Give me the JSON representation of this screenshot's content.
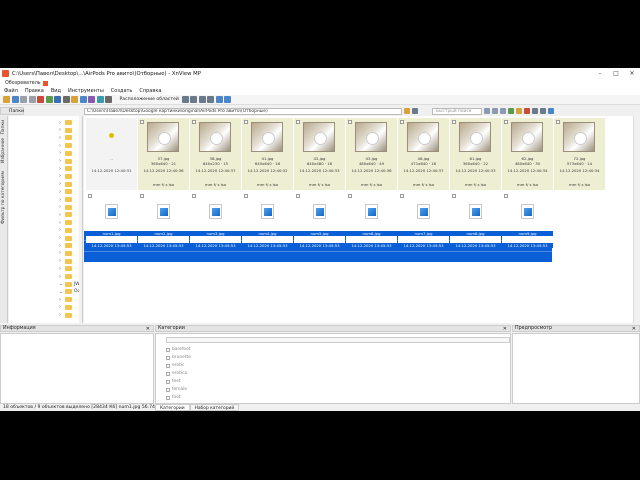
{
  "window": {
    "title": "C:\\Users\\Павел\\Desktop\\...\\AirPods Pro авито\\(Отборные) - XnView MP",
    "app_badge": "Обозреватель",
    "controls": [
      "–",
      "□",
      "✕"
    ]
  },
  "menu": [
    "Файл",
    "Правка",
    "Вид",
    "Инструменты",
    "Создать",
    "Справка"
  ],
  "toolbar": {
    "view_label": "Расположение областей"
  },
  "addressbar": {
    "tree_tab": "Папки",
    "path": "C:\\Users\\Павел\\Desktop\\Google картинки\\original\\AirPods Pro авито\\(Отборные)",
    "filter_placeholder": "Быстрый поиск"
  },
  "sidebar_tabs": [
    "Папки",
    "Избранное",
    "Фильтр по категориям"
  ],
  "tree": {
    "items": [
      "",
      "",
      "",
      "",
      "",
      "",
      "",
      "",
      "",
      "",
      "",
      "",
      "",
      "",
      "",
      "",
      "",
      "",
      "",
      "",
      "",
      "JW",
      "Ocn",
      "",
      "",
      ""
    ]
  },
  "thumbnails": [
    {
      "name": "..",
      "dims": "",
      "date": "14.12.2020 12:40:31",
      "rating": "",
      "type": "parent"
    },
    {
      "name": "37.jpg",
      "dims": "360x640 · 21",
      "date": "14.12.2020 12:40:36",
      "rating": "mm f/ s iso",
      "type": "photo"
    },
    {
      "name": "38.jpg",
      "dims": "640x230 · 15",
      "date": "14.12.2020 12:40:37",
      "rating": "mm f/ s iso",
      "type": "photo"
    },
    {
      "name": "41.jpg",
      "dims": "640x640 · 16",
      "date": "14.12.2020 12:40:32",
      "rating": "mm f/ s iso",
      "type": "photo"
    },
    {
      "name": "42.jpg",
      "dims": "640x480 · 16",
      "date": "14.12.2020 12:40:33",
      "rating": "mm f/ s iso",
      "type": "photo"
    },
    {
      "name": "43.jpg",
      "dims": "480x640 · 49",
      "date": "14.12.2020 12:40:38",
      "rating": "mm f/ s iso",
      "type": "photo"
    },
    {
      "name": "46.jpg",
      "dims": "471x640 · 16",
      "date": "14.12.2020 12:40:37",
      "rating": "mm f/ s iso",
      "type": "photo"
    },
    {
      "name": "61.jpg",
      "dims": "360x640 · 22",
      "date": "14.12.2020 12:40:33",
      "rating": "mm f/ s iso",
      "type": "photo"
    },
    {
      "name": "62.jpg",
      "dims": "480x640 · 30",
      "date": "14.12.2020 12:40:34",
      "rating": "mm f/ s iso",
      "type": "photo"
    },
    {
      "name": "72.jpg",
      "dims": "573x640 · 14",
      "date": "14.12.2020 12:40:34",
      "rating": "mm f/ s iso",
      "type": "photo"
    }
  ],
  "files": [
    {
      "name": "num1.jpg",
      "date": "14.12.2020 13:45:53"
    },
    {
      "name": "num2.jpg",
      "date": "14.12.2020 13:45:53"
    },
    {
      "name": "num3.jpg",
      "date": "14.12.2020 13:45:53"
    },
    {
      "name": "num4.jpg",
      "date": "14.12.2020 13:45:53"
    },
    {
      "name": "num5.jpg",
      "date": "14.12.2020 13:45:53"
    },
    {
      "name": "num6.jpg",
      "date": "14.12.2020 13:45:53"
    },
    {
      "name": "num7.jpg",
      "date": "14.12.2020 13:45:53"
    },
    {
      "name": "num8.jpg",
      "date": "14.12.2020 13:45:53"
    },
    {
      "name": "num9.jpg",
      "date": "14.12.2020 13:45:53"
    }
  ],
  "panels": {
    "info_title": "Информация",
    "categories_title": "Категории",
    "preview_title": "Предпросмотр",
    "categories": [
      "barefoot",
      "brunette",
      "erotic",
      "erotica",
      "feet",
      "female",
      "foot"
    ],
    "category_tabs": [
      "Категории",
      "Набор категорий"
    ]
  },
  "status": "18 объектов / 9 объектов выделено [28434 Кб]  num1.jpg  56.74 Кб",
  "colors": {
    "selection": "#0a5fd6",
    "thumb_bg": "#eeeed2",
    "accent": "#e8542b"
  }
}
